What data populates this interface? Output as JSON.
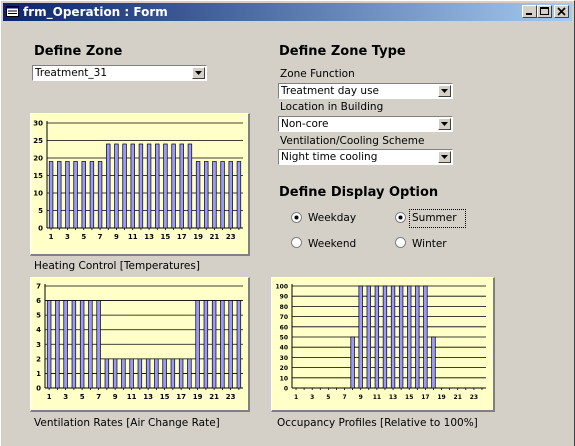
{
  "window": {
    "title": "frm_Operation : Form"
  },
  "define_zone": {
    "heading": "Define Zone",
    "zone_value": "Treatment_31"
  },
  "define_zone_type": {
    "heading": "Define Zone Type",
    "zone_function_label": "Zone Function",
    "zone_function_value": "Treatment day use",
    "location_label": "Location in Building",
    "location_value": "Non-core",
    "ventilation_label": "Ventilation/Cooling Scheme",
    "ventilation_value": "Night time cooling"
  },
  "display_option": {
    "heading": "Define Display Option",
    "weekday": "Weekday",
    "weekend": "Weekend",
    "summer": "Summer",
    "winter": "Winter",
    "day_selected": "weekday",
    "season_selected": "summer"
  },
  "chart_data": [
    {
      "type": "bar",
      "caption": "Heating Control [Temperatures]",
      "categories": [
        "1",
        "2",
        "3",
        "4",
        "5",
        "6",
        "7",
        "8",
        "9",
        "10",
        "11",
        "12",
        "13",
        "14",
        "15",
        "16",
        "17",
        "18",
        "19",
        "20",
        "21",
        "22",
        "23",
        "24"
      ],
      "xticks": [
        "1",
        "3",
        "5",
        "7",
        "9",
        "11",
        "13",
        "15",
        "17",
        "19",
        "21",
        "23"
      ],
      "values": [
        19,
        19,
        19,
        19,
        19,
        19,
        19,
        24,
        24,
        24,
        24,
        24,
        24,
        24,
        24,
        24,
        24,
        24,
        19,
        19,
        19,
        19,
        19,
        19
      ],
      "ylim": [
        0,
        30
      ],
      "yticks": [
        "0",
        "5",
        "10",
        "15",
        "20",
        "25",
        "30"
      ],
      "bar_color": "#9999ff"
    },
    {
      "type": "bar",
      "caption": "Ventilation Rates [Air Change Rate]",
      "categories": [
        "1",
        "2",
        "3",
        "4",
        "5",
        "6",
        "7",
        "8",
        "9",
        "10",
        "11",
        "12",
        "13",
        "14",
        "15",
        "16",
        "17",
        "18",
        "19",
        "20",
        "21",
        "22",
        "23",
        "24"
      ],
      "xticks": [
        "1",
        "3",
        "5",
        "7",
        "9",
        "11",
        "13",
        "15",
        "17",
        "19",
        "21",
        "23"
      ],
      "values": [
        6,
        6,
        6,
        6,
        6,
        6,
        6,
        2,
        2,
        2,
        2,
        2,
        2,
        2,
        2,
        2,
        2,
        2,
        6,
        6,
        6,
        6,
        6,
        6
      ],
      "ylim": [
        0,
        7
      ],
      "yticks": [
        "0",
        "1",
        "2",
        "3",
        "4",
        "5",
        "6",
        "7"
      ],
      "bar_color": "#9999ff"
    },
    {
      "type": "bar",
      "caption": "Occupancy Profiles [Relative to 100%]",
      "categories": [
        "1",
        "2",
        "3",
        "4",
        "5",
        "6",
        "7",
        "8",
        "9",
        "10",
        "11",
        "12",
        "13",
        "14",
        "15",
        "16",
        "17",
        "18",
        "19",
        "20",
        "21",
        "22",
        "23",
        "24"
      ],
      "xticks": [
        "1",
        "3",
        "5",
        "7",
        "9",
        "11",
        "13",
        "15",
        "17",
        "19",
        "21",
        "23"
      ],
      "values": [
        0,
        0,
        0,
        0,
        0,
        0,
        0,
        50,
        100,
        100,
        100,
        100,
        100,
        100,
        100,
        100,
        100,
        50,
        0,
        0,
        0,
        0,
        0,
        0
      ],
      "ylim": [
        0,
        100
      ],
      "yticks": [
        "0",
        "10",
        "20",
        "30",
        "40",
        "50",
        "60",
        "70",
        "80",
        "90",
        "100"
      ],
      "bar_color": "#9999ff"
    }
  ]
}
